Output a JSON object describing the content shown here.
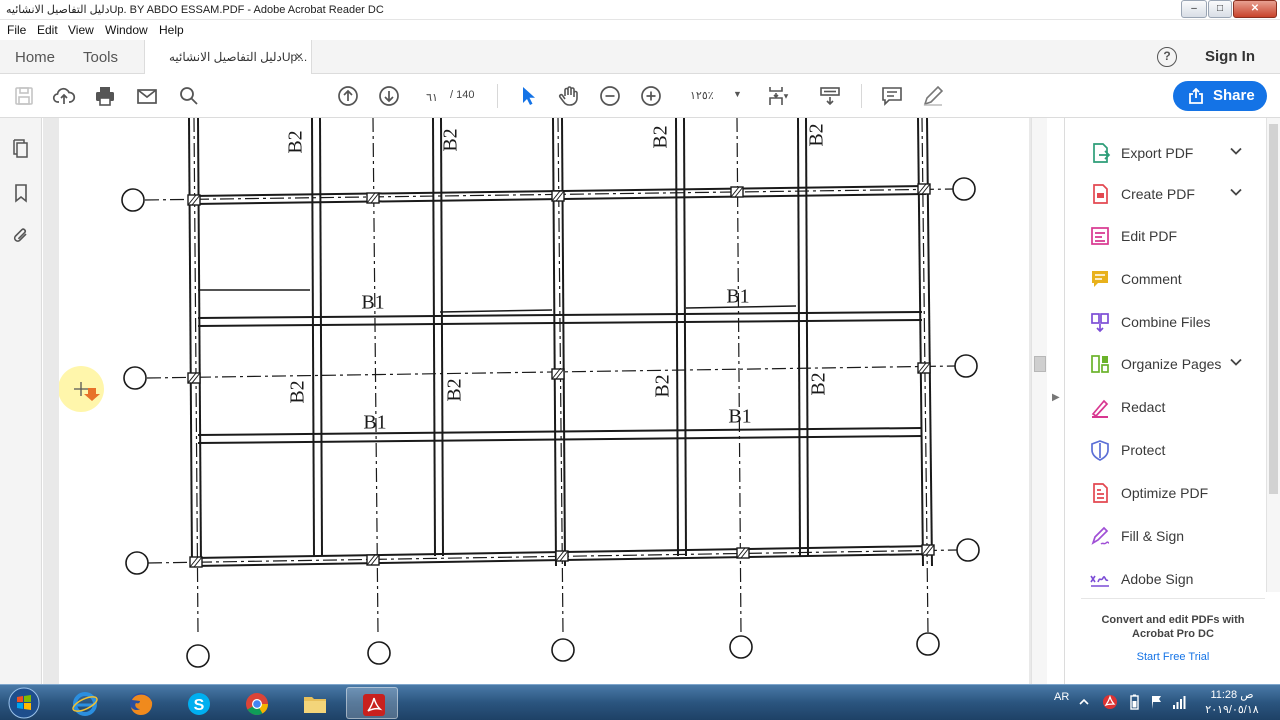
{
  "window": {
    "title": "دليل التفاصيل الانشائيهUp. BY ABDO ESSAM.PDF - Adobe Acrobat Reader DC",
    "minimize": "–",
    "maximize": "□",
    "close": "✕"
  },
  "menu": [
    "File",
    "Edit",
    "View",
    "Window",
    "Help"
  ],
  "tabs": {
    "home": "Home",
    "tools": "Tools",
    "document": "دليل التفاصيل الانشائيهUp...",
    "close": "×",
    "help": "?",
    "sign_in": "Sign In"
  },
  "toolbar": {
    "page_current": "٦١",
    "page_total": "/  140",
    "zoom": "١٢٥٪",
    "share": "Share"
  },
  "document": {
    "beam_labels": [
      "B2",
      "B2",
      "B2",
      "B2",
      "B1",
      "B1",
      "B2",
      "B2",
      "B2",
      "B2",
      "B1",
      "B1"
    ]
  },
  "tools_pane": {
    "tools": [
      {
        "label": "Export PDF",
        "icon": "export-pdf-icon",
        "color": "#2d9d78",
        "expandable": true
      },
      {
        "label": "Create PDF",
        "icon": "create-pdf-icon",
        "color": "#e34850",
        "expandable": true
      },
      {
        "label": "Edit PDF",
        "icon": "edit-pdf-icon",
        "color": "#d83790",
        "expandable": false
      },
      {
        "label": "Comment",
        "icon": "comment-icon",
        "color": "#e8b11c",
        "expandable": false
      },
      {
        "label": "Combine Files",
        "icon": "combine-files-icon",
        "color": "#7c4dd6",
        "expandable": false
      },
      {
        "label": "Organize Pages",
        "icon": "organize-pages-icon",
        "color": "#6bb32a",
        "expandable": true
      },
      {
        "label": "Redact",
        "icon": "redact-icon",
        "color": "#d83790",
        "expandable": false
      },
      {
        "label": "Protect",
        "icon": "protect-icon",
        "color": "#5b6fd6",
        "expandable": false
      },
      {
        "label": "Optimize PDF",
        "icon": "optimize-pdf-icon",
        "color": "#e34850",
        "expandable": false
      },
      {
        "label": "Fill & Sign",
        "icon": "fill-sign-icon",
        "color": "#a04fd6",
        "expandable": false
      },
      {
        "label": "Adobe Sign",
        "icon": "adobe-sign-icon",
        "color": "#7c4dd6",
        "expandable": false
      }
    ],
    "promo_title": "Convert and edit PDFs with Acrobat Pro DC",
    "promo_link": "Start Free Trial"
  },
  "taskbar": {
    "apps": [
      "internet-explorer",
      "firefox",
      "skype",
      "chrome",
      "file-explorer",
      "acrobat-reader"
    ],
    "active_app": "acrobat-reader",
    "language": "AR",
    "time": "ص 11:28",
    "date": "٢٠١٩/٠٥/١٨"
  }
}
